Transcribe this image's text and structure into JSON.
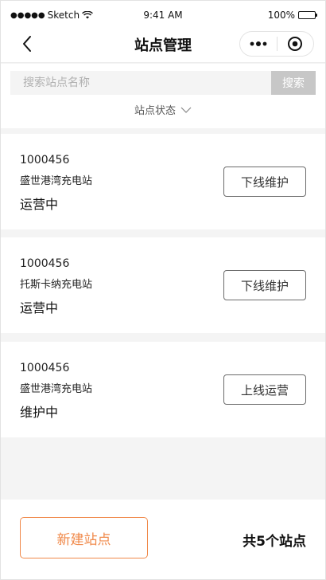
{
  "status_bar": {
    "carrier": "Sketch",
    "time": "9:41 AM",
    "battery": "100%"
  },
  "nav": {
    "title": "站点管理",
    "more_label": "•••"
  },
  "search": {
    "placeholder": "搜索站点名称",
    "value": "",
    "button_label": "搜索"
  },
  "filter": {
    "label": "站点状态"
  },
  "stations": [
    {
      "code": "1000456",
      "name": "盛世港湾充电站",
      "state": "运营中",
      "action": "下线维护"
    },
    {
      "code": "1000456",
      "name": "托斯卡纳充电站",
      "state": "运营中",
      "action": "下线维护"
    },
    {
      "code": "1000456",
      "name": "盛世港湾充电站",
      "state": "维护中",
      "action": "上线运营"
    }
  ],
  "footer": {
    "create_label": "新建站点",
    "total_label": "共5个站点"
  },
  "colors": {
    "accent": "#f0894a",
    "search_button": "#c7c7c7",
    "background": "#f4f4f4"
  }
}
